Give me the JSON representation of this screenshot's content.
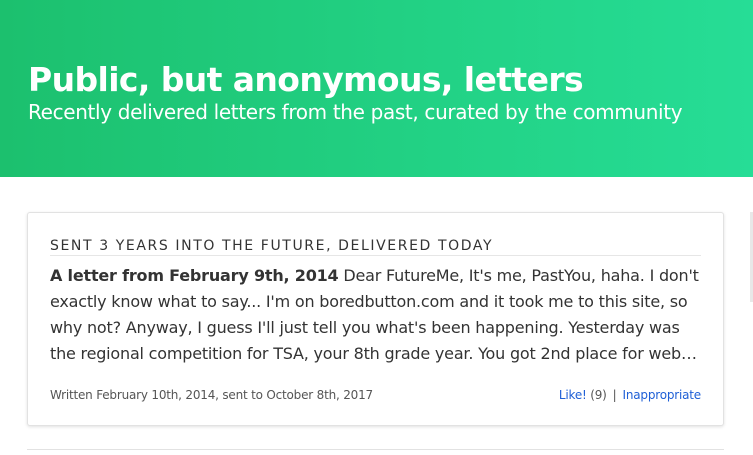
{
  "hero": {
    "title": "Public, but anonymous, letters",
    "subtitle": "Recently delivered letters from the past, curated by the community"
  },
  "letter": {
    "kicker": "SENT 3 YEARS INTO THE FUTURE, DELIVERED TODAY",
    "heading": "A letter from February 9th, 2014",
    "body": " Dear FutureMe, It's me, PastYou, haha. I don't exactly know what to say... I'm on boredbutton.com and it took me to this site, so why not? Anyway, I guess I'll just tell you what's been happening. Yesterday was the regional competition for TSA, your 8th grade year. You got 2nd place for web design...",
    "written": "Written February 10th, 2014, sent to October 8th, 2017",
    "like_label": "Like!",
    "like_count": "(9)",
    "separator": "|",
    "inappropriate_label": "Inappropriate"
  },
  "colors": {
    "hero_gradient_start": "#1cc06e",
    "hero_gradient_end": "#26dd96",
    "link": "#1e5fd6"
  }
}
